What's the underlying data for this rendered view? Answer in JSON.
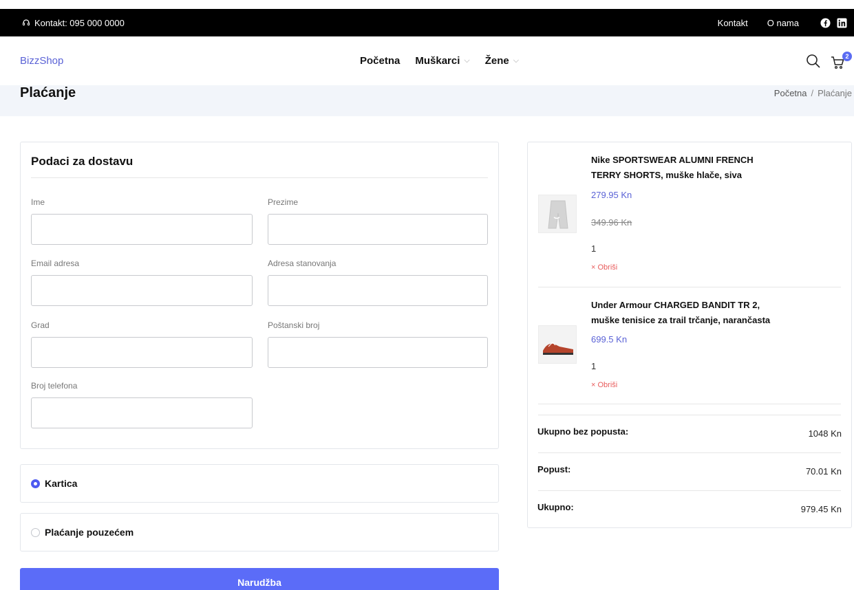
{
  "topbar": {
    "contact_text": "Kontakt: 095 000 0000",
    "links": [
      "Kontakt",
      "O nama"
    ]
  },
  "header": {
    "logo": "BizzShop",
    "nav": [
      {
        "label": "Početna",
        "dropdown": false
      },
      {
        "label": "Muškarci",
        "dropdown": true
      },
      {
        "label": "Žene",
        "dropdown": true
      }
    ],
    "cart_count": "2"
  },
  "title_bar": {
    "title": "Plaćanje",
    "breadcrumb": [
      "Početna",
      "Plaćanje"
    ]
  },
  "shipping": {
    "heading": "Podaci za dostavu",
    "fields": {
      "first_name": {
        "label": "Ime",
        "value": ""
      },
      "last_name": {
        "label": "Prezime",
        "value": ""
      },
      "email": {
        "label": "Email adresa",
        "value": ""
      },
      "address": {
        "label": "Adresa stanovanja",
        "value": ""
      },
      "city": {
        "label": "Grad",
        "value": ""
      },
      "postal": {
        "label": "Poštanski broj",
        "value": ""
      },
      "phone": {
        "label": "Broj telefona",
        "value": ""
      }
    }
  },
  "payment": {
    "options": [
      {
        "label": "Kartica",
        "selected": true
      },
      {
        "label": "Plaćanje pouzećem",
        "selected": false
      }
    ],
    "submit_label": "Narudžba"
  },
  "cart": {
    "items": [
      {
        "name_line1": "Nike SPORTSWEAR ALUMNI FRENCH",
        "name_line2": "TERRY SHORTS, muške hlače, siva",
        "price": "279.95 Kn",
        "old_price": "349.96 Kn",
        "quantity": "1",
        "remove_label": "Obriši"
      },
      {
        "name_line1": "Under Armour CHARGED BANDIT TR 2,",
        "name_line2": "muške tenisice za trail trčanje, narančasta",
        "price": "699.5 Kn",
        "quantity": "1",
        "remove_label": "Obriši"
      }
    ],
    "totals": [
      {
        "label": "Ukupno bez popusta:",
        "value": "1048 Kn"
      },
      {
        "label": "Popust:",
        "value": "70.01 Kn"
      },
      {
        "label": "Ukupno:",
        "value": "979.45 Kn"
      }
    ]
  },
  "colors": {
    "accent": "#5b6cf8",
    "logo": "#5a62d6",
    "remove": "#e85b5b",
    "topbar": "#000000",
    "title_bar": "#f2f5fa"
  }
}
